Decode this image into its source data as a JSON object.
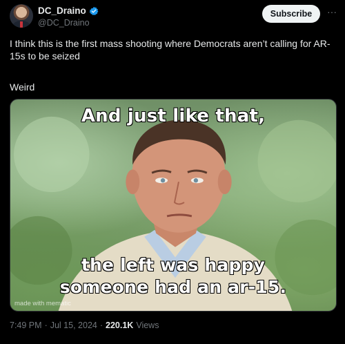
{
  "author": {
    "name": "DC_Draino",
    "handle": "@DC_Draino",
    "verified": true,
    "verified_color": "#1d9bf0"
  },
  "actions": {
    "subscribe_label": "Subscribe",
    "more_icon": "more-dots-icon"
  },
  "tweet": {
    "text": "I think this is the first mass shooting where Democrats aren’t calling for AR-15s to be seized",
    "text_2": "Weird"
  },
  "meme": {
    "caption_top": "And just like that,",
    "caption_bottom_1": "the left was happy",
    "caption_bottom_2": "someone had an ar-15.",
    "watermark": "made with mematic"
  },
  "meta": {
    "time": "7:49 PM",
    "date": "Jul 15, 2024",
    "separator": "·",
    "views_count": "220.1K",
    "views_label": "Views"
  }
}
